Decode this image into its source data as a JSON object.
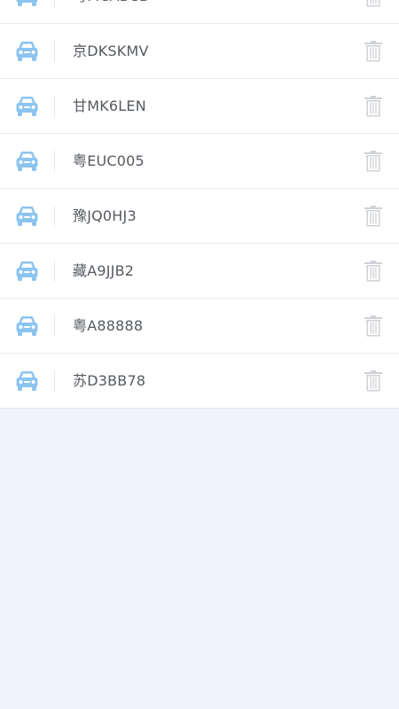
{
  "vehicles": [
    {
      "plate": "粤MCABCD"
    },
    {
      "plate": "京DKSKMV"
    },
    {
      "plate": "甘MK6LEN"
    },
    {
      "plate": "粤EUC005"
    },
    {
      "plate": "豫JQ0HJ3"
    },
    {
      "plate": "藏A9JJB2"
    },
    {
      "plate": "粤A88888"
    },
    {
      "plate": "苏D3BB78"
    }
  ],
  "icons": {
    "vehicle": "car-icon",
    "delete": "trash-icon"
  },
  "colors": {
    "car_icon": "#8cc4f0",
    "trash_icon": "#cfd2d6",
    "plate_text": "#555a60",
    "background": "#f0f3f8"
  }
}
